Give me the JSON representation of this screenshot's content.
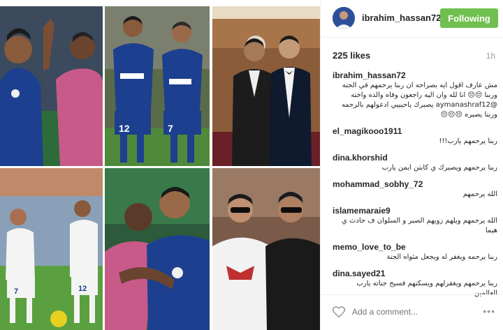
{
  "post": {
    "username": "ibrahim_hassan72",
    "follow_label": "Following",
    "likes": "225 likes",
    "time": "1h",
    "add_comment_placeholder": "Add a comment...",
    "more_label": "•••"
  },
  "comments": [
    {
      "user": "ibrahim_hassan72",
      "text": "مش عارف اقول ايه بصراحه ان ربنا يرحمهم في الجنه وربنا 😔😔 انا لله وان اليه راجعون وفاه والده واخته @aymanashraf12 يصبرك ياحبيبي ادعولهم بالرحمه وربنا يصبره 😔😔😔"
    },
    {
      "user": "el_magikooo1911",
      "text": "ربنا يرحمهم يارب!!!"
    },
    {
      "user": "dina.khorshid",
      "text": "ربنا يرحمهم ويصبرك ي كابتن ايمن يارب"
    },
    {
      "user": "mohammad_sobhy_72",
      "text": "الله يرحمهم"
    },
    {
      "user": "islamemaraie9",
      "text": "الله يرحمهم ويلهم زويهم الصبر و السلوان ف حادث ي هيما"
    },
    {
      "user": "memo_love_to_be",
      "text": "ربنا يرحمه ويغفر له ويجعل مثواه الجنة"
    },
    {
      "user": "dina.sayed21",
      "text": "ربنا يرحمهم ويغفرلهم ويسكنهم فسيح جناته يارب العالمين"
    }
  ],
  "colors": {
    "follow_bg": "#70c050",
    "jersey_blue": "#1d3f8f",
    "jersey_pink": "#c85a8a"
  }
}
